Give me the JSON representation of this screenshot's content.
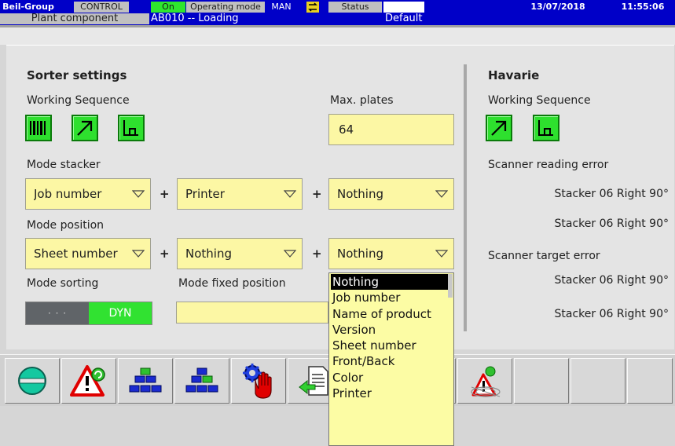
{
  "header": {
    "brand": "Beil-Group",
    "control_label": "CONTROL",
    "on_label": "On",
    "operating_mode_label": "Operating mode",
    "operating_mode_value": "MAN",
    "status_label": "Status",
    "date": "13/07/2018",
    "time": "11:55:06",
    "plant_component_label": "Plant component",
    "plant_component_value": "AB010 -- Loading",
    "default_label": "Default"
  },
  "sorter": {
    "title": "Sorter settings",
    "working_sequence_label": "Working Sequence",
    "working_sequence_buttons": [
      "barcode-icon",
      "arrow-up-right-icon",
      "step-icon"
    ],
    "max_plates_label": "Max. plates",
    "max_plates_value": "64",
    "mode_stacker_label": "Mode stacker",
    "mode_stacker": [
      "Job number",
      "Printer",
      "Nothing"
    ],
    "mode_position_label": "Mode position",
    "mode_position": [
      "Sheet number",
      "Nothing",
      "Nothing"
    ],
    "plus": "+",
    "mode_sorting_label": "Mode sorting",
    "mode_sorting_left": "· · ·",
    "mode_sorting_right": "DYN",
    "mode_fixed_position_label": "Mode fixed position"
  },
  "havarie": {
    "title": "Havarie",
    "working_sequence_label": "Working Sequence",
    "scanner_reading_error_label": "Scanner reading error",
    "scanner_reading_values": [
      "Stacker 06  Right 90°",
      "Stacker 06  Right 90°"
    ],
    "scanner_target_error_label": "Scanner target error",
    "scanner_target_values": [
      "Stacker 06  Right 90°",
      "Stacker 06  Right 90°"
    ]
  },
  "dropdown_options": [
    "Nothing",
    "Job number",
    "Name of product",
    "Version",
    "Sheet number",
    "Front/Back",
    "Color",
    "Printer"
  ],
  "colors": {
    "title_bar": "#0000c8",
    "active_green": "#2ee02e",
    "field_yellow": "#fcf7a4",
    "alert_red": "#e00000"
  }
}
